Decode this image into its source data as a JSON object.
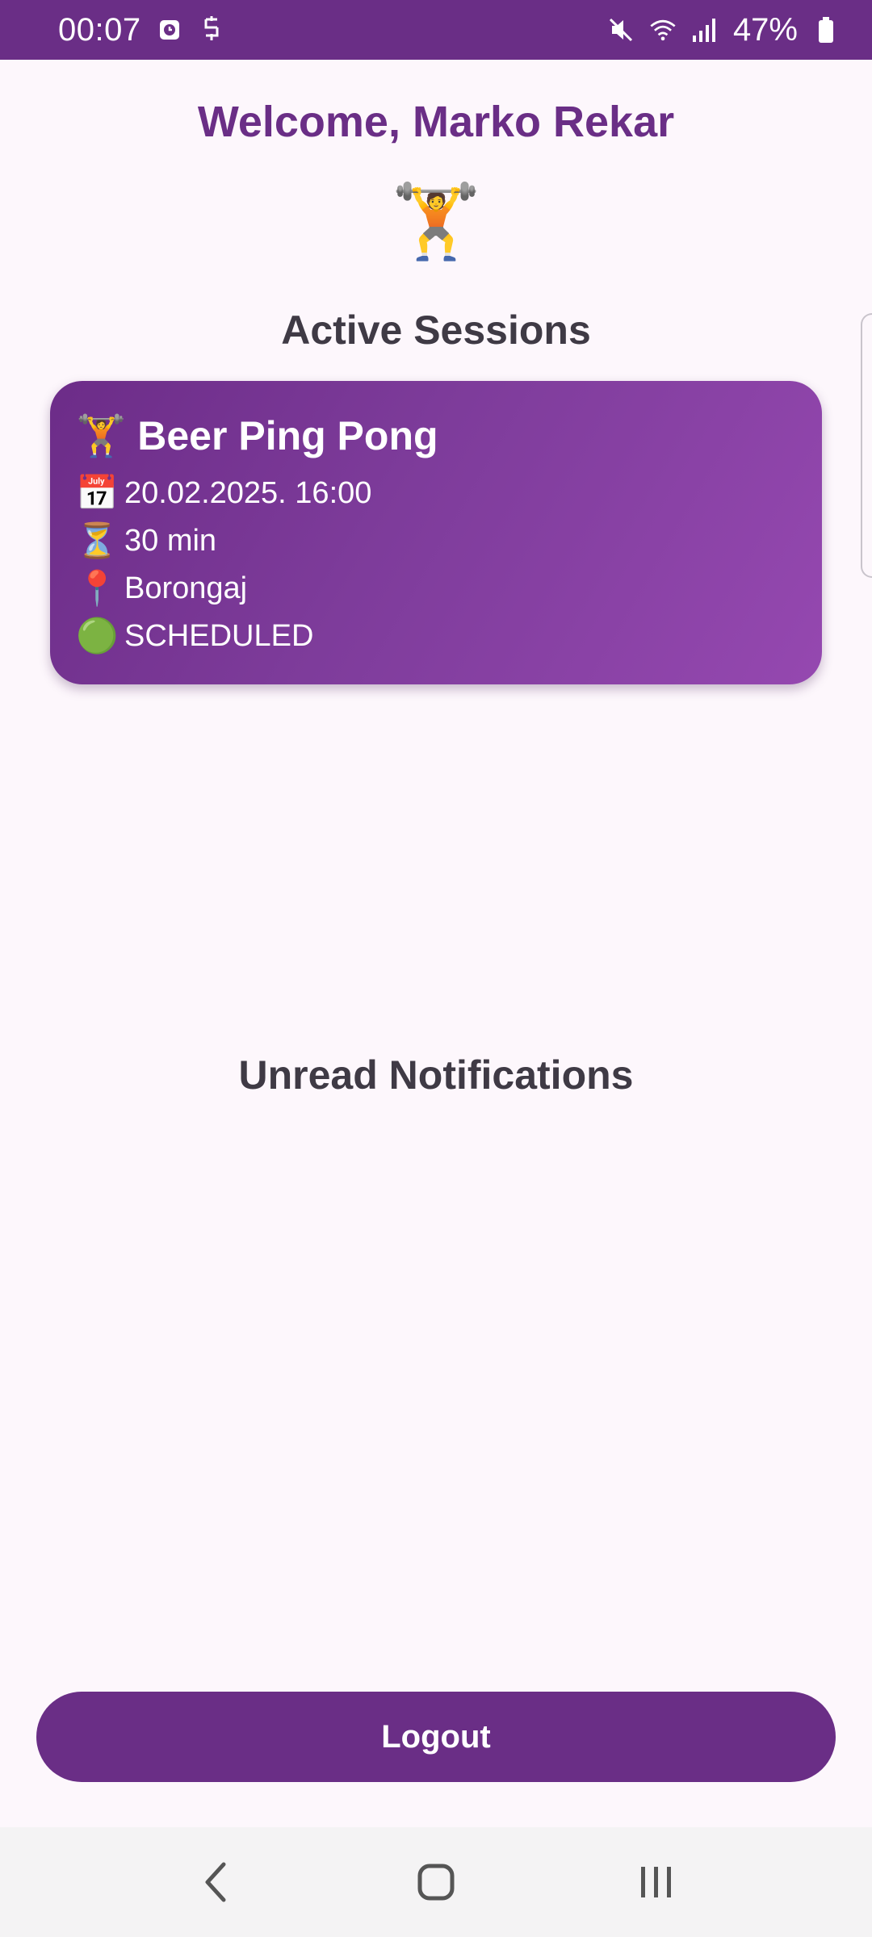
{
  "status_bar": {
    "time": "00:07",
    "battery": "47%",
    "icons": [
      "alarm-icon",
      "accessibility-icon",
      "mute-icon",
      "wifi-icon",
      "signal-icon",
      "battery-icon"
    ]
  },
  "header": {
    "welcome": "Welcome, Marko Rekar",
    "hero_emoji": "🏋️"
  },
  "active_sessions": {
    "title": "Active Sessions",
    "cards": [
      {
        "title_emoji": "🏋️",
        "title": "Beer Ping Pong",
        "date_emoji": "📅",
        "date": "20.02.2025. 16:00",
        "duration_emoji": "⏳",
        "duration": "30 min",
        "location_emoji": "📍",
        "location": "Borongaj",
        "status_emoji": "🟢",
        "status": "SCHEDULED"
      }
    ]
  },
  "notifications": {
    "title": "Unread Notifications"
  },
  "actions": {
    "logout": "Logout"
  },
  "colors": {
    "primary": "#6a2e86",
    "background": "#fdf7fc",
    "heading_text": "#3f3a45"
  },
  "nav_bar": {
    "icons": [
      "back-icon",
      "home-icon",
      "recents-icon"
    ]
  }
}
